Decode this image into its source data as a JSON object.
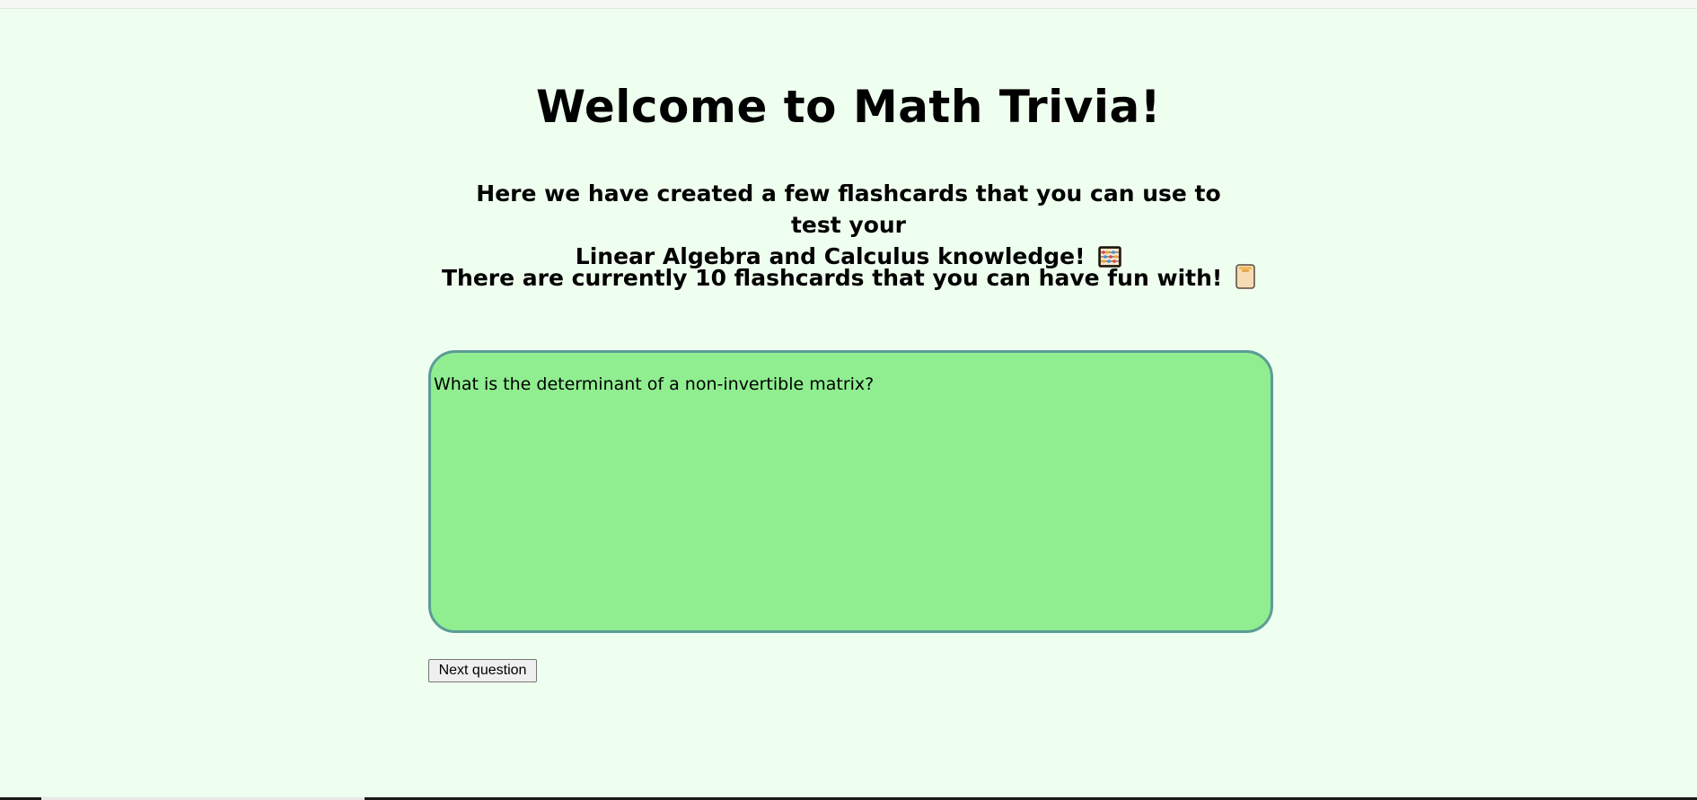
{
  "header": {
    "title": "Welcome to Math Trivia!",
    "intro_line1": "Here we have created a few flashcards that you can use to test your",
    "intro_line2": "Linear Algebra and Calculus knowledge!",
    "intro_icon": "abacus-icon",
    "count_text": "There are currently 10 flashcards that you can have fun with!",
    "count_icon": "card-index-icon",
    "flashcard_count": 10
  },
  "flashcard": {
    "question": "What is the determinant of a non-invertible matrix?"
  },
  "controls": {
    "next_label": "Next question"
  },
  "colors": {
    "page_background": "#efffef",
    "card_background": "#90ee90",
    "card_border": "#5b9c96",
    "text": "#000000"
  }
}
